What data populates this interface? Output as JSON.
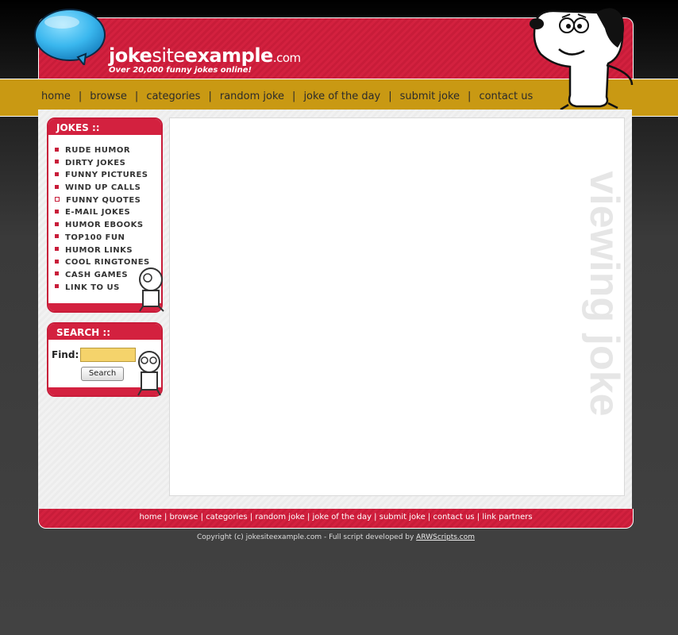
{
  "header": {
    "logo_joke": "joke",
    "logo_site": "site",
    "logo_example": "example",
    "logo_com": ".com",
    "tagline": "Over 20,000 funny jokes online!"
  },
  "nav": {
    "items": [
      "home",
      "browse",
      "categories",
      "random joke",
      "joke of the day",
      "submit joke",
      "contact us"
    ],
    "separator": "|"
  },
  "sidebar": {
    "jokes_title": "JOKES ::",
    "jokes_items": [
      "RUDE HUMOR",
      "DIRTY JOKES",
      "FUNNY PICTURES",
      "WIND UP CALLS",
      "FUNNY QUOTES",
      "E-MAIL JOKES",
      "HUMOR EBOOKS",
      "TOP100 FUN",
      "HUMOR LINKS",
      "COOL RINGTONES",
      "CASH GAMES",
      "LINK TO US"
    ],
    "search_title": "SEARCH ::",
    "find_label": "Find:",
    "find_value": "",
    "search_button": "Search"
  },
  "main": {
    "watermark": "viewing joke"
  },
  "footer": {
    "links": [
      "home",
      "browse",
      "categories",
      "random joke",
      "joke of the day",
      "submit joke",
      "contact us",
      "link partners"
    ],
    "copyright_prefix": "Copyright (c) jokesiteexample.com - Full script developed by ",
    "copyright_link": "ARWScripts.com"
  },
  "colors": {
    "brand_red": "#d3213f",
    "nav_gold": "#c99913",
    "bubble_blue": "#3ab7ee"
  }
}
